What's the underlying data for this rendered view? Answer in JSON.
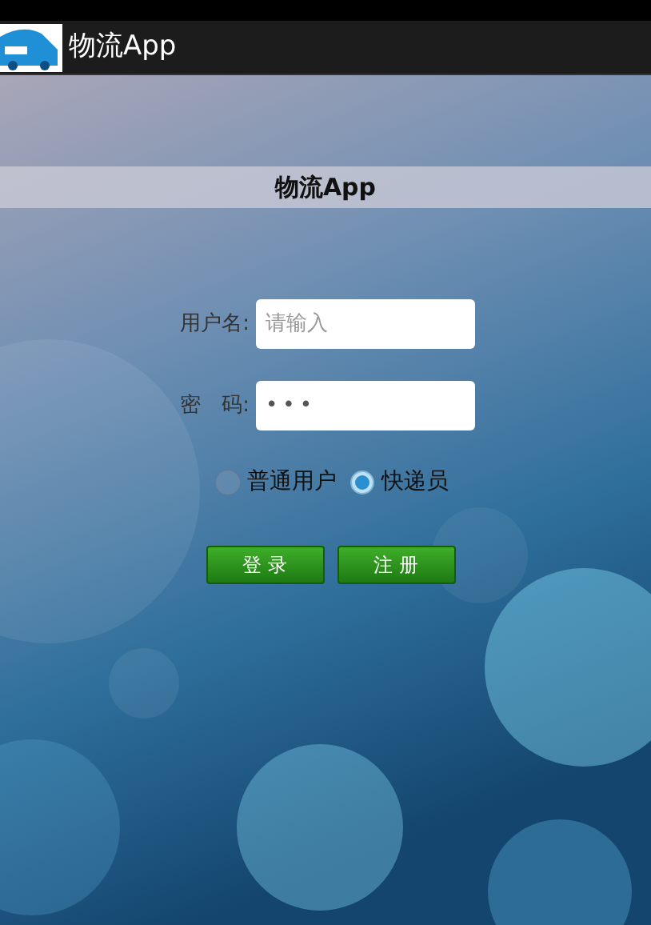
{
  "app_bar": {
    "title": "物流App"
  },
  "header": {
    "title": "物流App"
  },
  "form": {
    "fields": [
      {
        "label": "用户名:",
        "placeholder": "请输入",
        "kind": "text"
      },
      {
        "label": "密　码:",
        "value": "•••",
        "kind": "password"
      }
    ],
    "roles": [
      {
        "label": "普通用户",
        "selected": false
      },
      {
        "label": "快递员",
        "selected": true
      }
    ],
    "buttons": [
      "登 录",
      "注 册"
    ]
  }
}
